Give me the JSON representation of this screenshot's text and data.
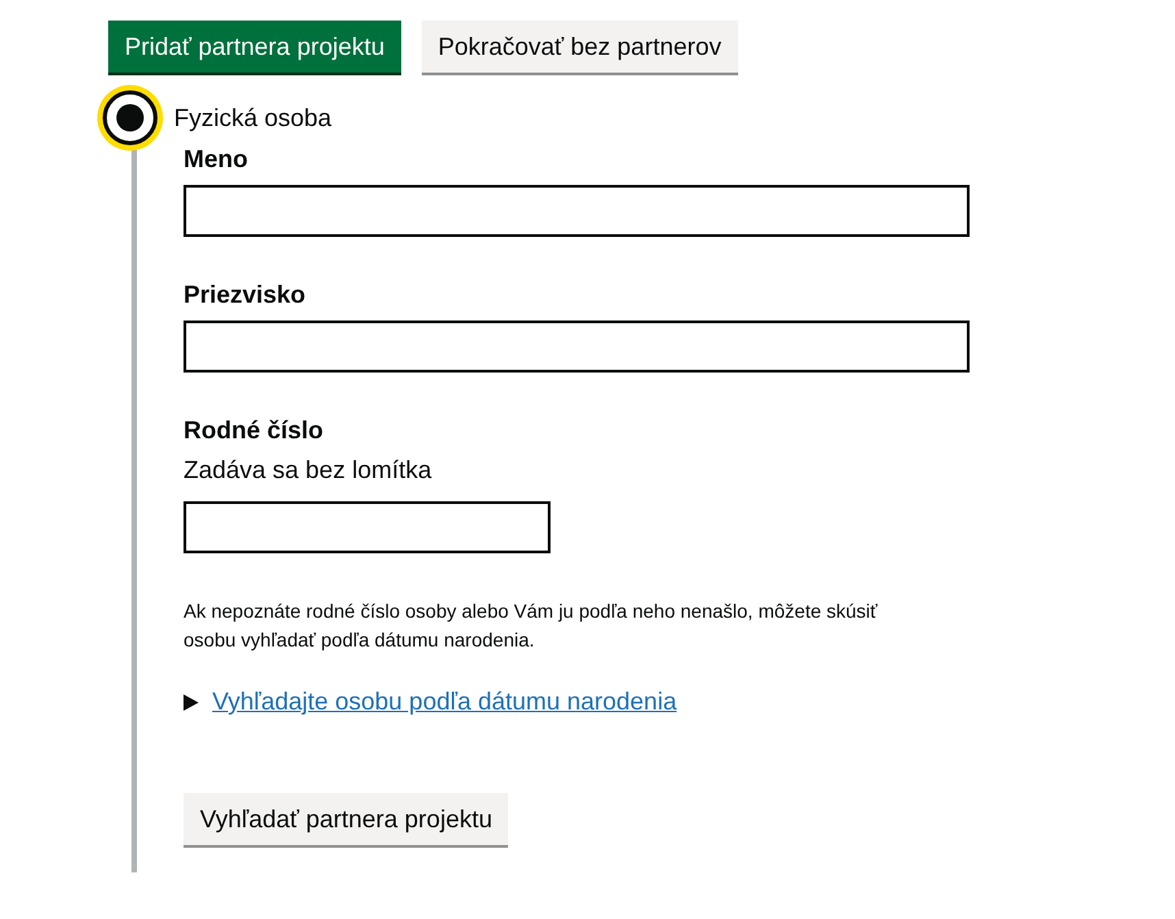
{
  "buttons": [
    {
      "label": "Pridať partnera projektu",
      "kind": "primary"
    },
    {
      "label": "Pokračovať bez partnerov",
      "kind": "secondary"
    }
  ],
  "radio": {
    "label": "Fyzická osoba",
    "selected": true,
    "focused": true
  },
  "fields": [
    {
      "label": "Meno",
      "kind": "wide"
    },
    {
      "label": "Priezvisko",
      "kind": "wide"
    },
    {
      "label": "Rodné číslo",
      "hint": "Zadáva sa bez lomítka",
      "kind": "narrow"
    }
  ],
  "note": "Ak nepoznáte rodné číslo osoby alebo Vám ju podľa neho nenašlo, môžete skúsiť osobu vyhľadať podľa dátumu narodenia.",
  "details": {
    "summary": "Vyhľadajte osobu podľa dátumu narodenia",
    "expanded": false
  },
  "search_button": "Vyhľadať partnera projektu"
}
